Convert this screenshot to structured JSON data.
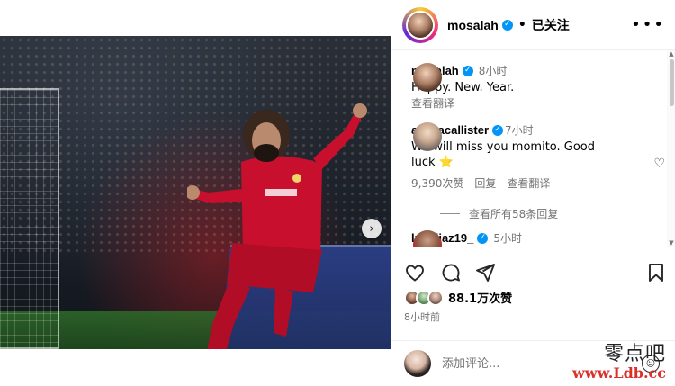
{
  "post": {
    "author": "mosalah",
    "follow_status": "已关注",
    "separator": "•",
    "more_icon": "more-horizontal-icon"
  },
  "caption": {
    "username": "mosalah",
    "time": "8小时",
    "text": "Happy. New. Year.",
    "translate": "查看翻译"
  },
  "comments": [
    {
      "username": "alemacallister",
      "time": "7小时",
      "text": "We will miss you momito. Good luck ⭐",
      "likes": "9,390次赞",
      "reply": "回复",
      "translate": "查看翻译",
      "view_replies": "查看所有58条回复"
    },
    {
      "username": "luisdiaz19_",
      "time": "5小时"
    }
  ],
  "engagement": {
    "likes_count": "88.1万次赞",
    "posted": "8小时前"
  },
  "add_comment": {
    "placeholder": "添加评论..."
  },
  "watermark": {
    "top": "零点吧",
    "bottom": "www.Ldb.cc"
  },
  "colors": {
    "verified": "#0095f6",
    "secondary_text": "#737373",
    "jersey_red": "#c8102e"
  }
}
